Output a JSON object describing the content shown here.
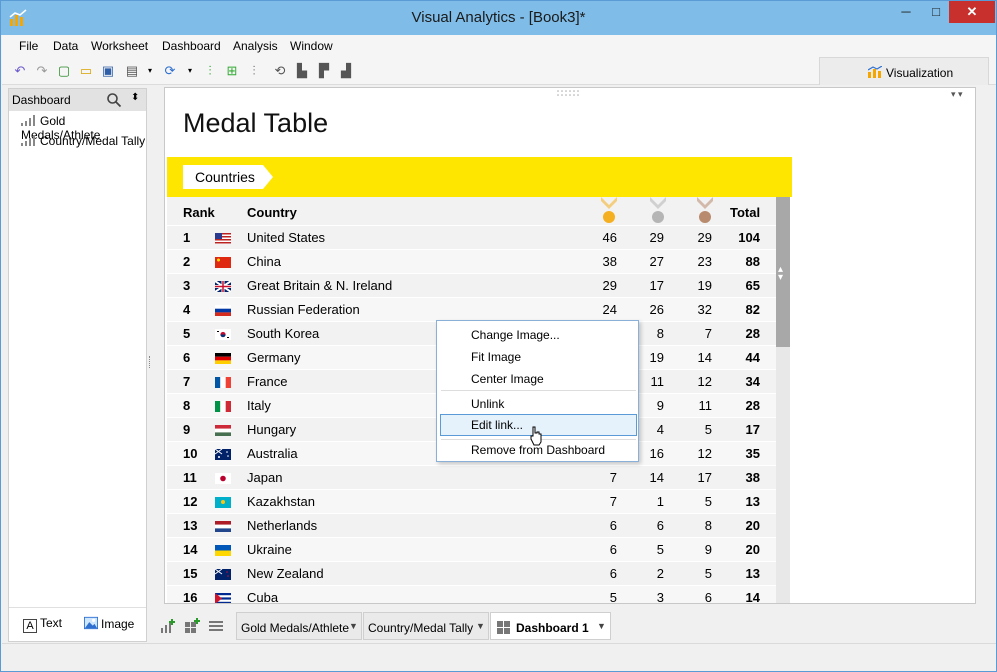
{
  "window": {
    "title": "Visual Analytics - [Book3]*",
    "controls": {
      "minimize": "─",
      "maximize": "□",
      "close": "✕"
    }
  },
  "menu": [
    "File",
    "Data",
    "Worksheet",
    "Dashboard",
    "Analysis",
    "Window"
  ],
  "visualization_tab": "Visualization",
  "sidebar": {
    "title": "Dashboard",
    "items": [
      "Gold Medals/Athlete",
      "Country/Medal Tally"
    ],
    "objects": [
      {
        "label": "Text",
        "icon": "text-object-icon"
      },
      {
        "label": "Image",
        "icon": "image-object-icon"
      }
    ]
  },
  "dashboard": {
    "title": "Medal Table",
    "banner_label": "Countries",
    "headers": {
      "rank": "Rank",
      "country": "Country",
      "gold_icon": "gold-medal-icon",
      "silver_icon": "silver-medal-icon",
      "bronze_icon": "bronze-medal-icon",
      "total": "Total"
    },
    "colors": {
      "banner": "#FFE600",
      "gold": "#F5B021",
      "silver": "#B5B5B5",
      "bronze": "#B98B6E"
    },
    "rows": [
      {
        "rank": "1",
        "flag": "us-flag-icon",
        "country": "United States",
        "gold": "46",
        "silver": "29",
        "bronze": "29",
        "total": "104"
      },
      {
        "rank": "2",
        "flag": "cn-flag-icon",
        "country": "China",
        "gold": "38",
        "silver": "27",
        "bronze": "23",
        "total": "88"
      },
      {
        "rank": "3",
        "flag": "gb-flag-icon",
        "country": "Great Britain & N. Ireland",
        "gold": "29",
        "silver": "17",
        "bronze": "19",
        "total": "65"
      },
      {
        "rank": "4",
        "flag": "ru-flag-icon",
        "country": "Russian Federation",
        "gold": "24",
        "silver": "26",
        "bronze": "32",
        "total": "82"
      },
      {
        "rank": "5",
        "flag": "kr-flag-icon",
        "country": "South Korea",
        "gold": "",
        "silver": "8",
        "bronze": "7",
        "total": "28"
      },
      {
        "rank": "6",
        "flag": "de-flag-icon",
        "country": "Germany",
        "gold": "",
        "silver": "19",
        "bronze": "14",
        "total": "44"
      },
      {
        "rank": "7",
        "flag": "fr-flag-icon",
        "country": "France",
        "gold": "",
        "silver": "11",
        "bronze": "12",
        "total": "34"
      },
      {
        "rank": "8",
        "flag": "it-flag-icon",
        "country": "Italy",
        "gold": "",
        "silver": "9",
        "bronze": "11",
        "total": "28"
      },
      {
        "rank": "9",
        "flag": "hu-flag-icon",
        "country": "Hungary",
        "gold": "",
        "silver": "4",
        "bronze": "5",
        "total": "17"
      },
      {
        "rank": "10",
        "flag": "au-flag-icon",
        "country": "Australia",
        "gold": "",
        "silver": "16",
        "bronze": "12",
        "total": "35"
      },
      {
        "rank": "11",
        "flag": "jp-flag-icon",
        "country": "Japan",
        "gold": "7",
        "silver": "14",
        "bronze": "17",
        "total": "38"
      },
      {
        "rank": "12",
        "flag": "kz-flag-icon",
        "country": "Kazakhstan",
        "gold": "7",
        "silver": "1",
        "bronze": "5",
        "total": "13"
      },
      {
        "rank": "13",
        "flag": "nl-flag-icon",
        "country": "Netherlands",
        "gold": "6",
        "silver": "6",
        "bronze": "8",
        "total": "20"
      },
      {
        "rank": "14",
        "flag": "ua-flag-icon",
        "country": "Ukraine",
        "gold": "6",
        "silver": "5",
        "bronze": "9",
        "total": "20"
      },
      {
        "rank": "15",
        "flag": "nz-flag-icon",
        "country": "New Zealand",
        "gold": "6",
        "silver": "2",
        "bronze": "5",
        "total": "13"
      },
      {
        "rank": "16",
        "flag": "cu-flag-icon",
        "country": "Cuba",
        "gold": "5",
        "silver": "3",
        "bronze": "6",
        "total": "14"
      }
    ]
  },
  "context_menu": {
    "items": [
      "Change Image...",
      "Fit Image",
      "Center Image",
      "Unlink",
      "Edit link...",
      "Remove from Dashboard"
    ],
    "highlighted": "Edit link..."
  },
  "sheet_tabs": [
    {
      "label": "Gold Medals/Athlete",
      "active": false
    },
    {
      "label": "Country/Medal Tally",
      "active": false
    },
    {
      "label": "Dashboard 1",
      "active": true
    }
  ]
}
